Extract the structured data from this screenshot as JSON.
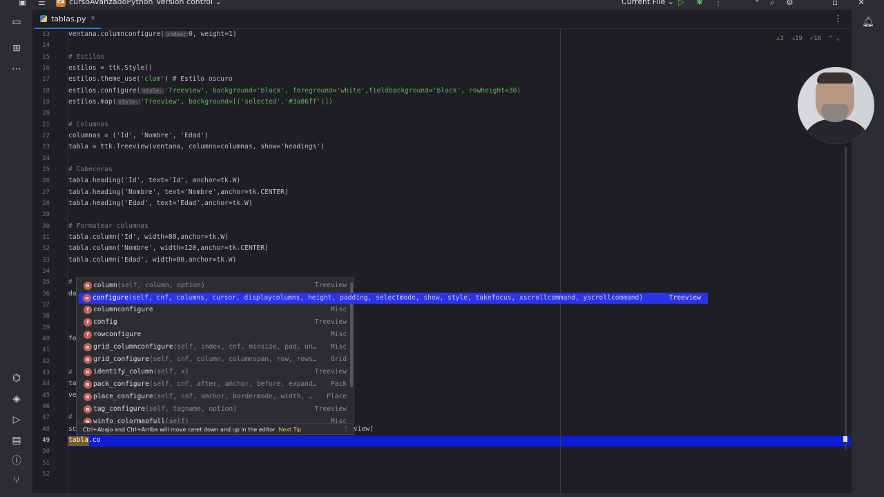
{
  "topbar": {
    "project_initials": "CA",
    "project_name": "cursoAvanzadoPython",
    "vcs_label": "Version control",
    "run_config": "Current File"
  },
  "tab": {
    "file_name": "tablas.py"
  },
  "inspection": {
    "warnings": "3",
    "weak_warnings": "19",
    "typos": "16"
  },
  "gutter": {
    "lines": [
      "13",
      "14",
      "15",
      "16",
      "17",
      "18",
      "19",
      "20",
      "21",
      "22",
      "23",
      "24",
      "25",
      "26",
      "27",
      "28",
      "29",
      "30",
      "31",
      "32",
      "33",
      "34",
      "35",
      "36",
      "37",
      "38",
      "39",
      "40",
      "41",
      "42",
      "43",
      "44",
      "45",
      "46",
      "47",
      "48",
      "49",
      "50",
      "51",
      "52"
    ],
    "active_line": "49"
  },
  "code": {
    "l13": "ventana.columnconfigure(",
    "l13_hint": "index:",
    "l13_b": "0, weight=1)",
    "l15": "# Estilos",
    "l16": "estilos = ttk.Style()",
    "l17a": "estilos.theme_use(",
    "l17b": "'clam'",
    "l17c": ") # Estilo oscuro",
    "l18a": "estilos.configure(",
    "l18_hint": "style:",
    "l18b": "'Treeview', background='black', foreground='white',fieldbackground='black', rowheight=30)",
    "l19a": "estilos.map(",
    "l19_hint": "style:",
    "l19b": "'Treeview', background=[('selected','#3a86ff')])",
    "l21": "# Columnas",
    "l22": "columnas = ('Id', 'Nombre', 'Edad')",
    "l23": "tabla = ttk.Treeview(ventana, columns=columnas, show='headings')",
    "l25": "# Cabeceras",
    "l26": "tabla.heading('Id', text='Id', anchor=tk.W)",
    "l27": "tabla.heading('Nombre', text='Nombre',anchor=tk.CENTER)",
    "l28": "tabla.heading('Edad', text='Edad',anchor=tk.W)",
    "l30": "# Formatear columnas",
    "l31": "tabla.column('Id', width=80,anchor=tk.W)",
    "l32": "tabla.column('Nombre', width=120,anchor=tk.CENTER)",
    "l33": "tabla.column('Edad', width=80,anchor=tk.W)",
    "l35": "#",
    "l36": "da",
    "l40": "fo",
    "l43": "#",
    "l44": "ta",
    "l45": "ve",
    "l47": "#",
    "l48": "sc",
    "l48_tail": "view)",
    "l49a": "tabla",
    "l49b": ".co"
  },
  "completion": {
    "items": [
      {
        "badge": "m",
        "name": "column",
        "params": "(self, column, option)",
        "type": "Treeview"
      },
      {
        "badge": "f",
        "name": "columnconfigure",
        "params": "",
        "type": "Misc"
      },
      {
        "badge": "f",
        "name": "config",
        "params": "",
        "type": "Treeview"
      },
      {
        "badge": "f",
        "name": "rowconfigure",
        "params": "",
        "type": "Misc"
      },
      {
        "badge": "m",
        "name": "grid_columnconfigure",
        "params": "(self, index, cnf, minsize, pad, un…",
        "type": "Misc"
      },
      {
        "badge": "m",
        "name": "grid_configure",
        "params": "(self, cnf, column, columnspan, row, rows…",
        "type": "Grid"
      },
      {
        "badge": "m",
        "name": "identify_column",
        "params": "(self, x)",
        "type": "Treeview"
      },
      {
        "badge": "m",
        "name": "pack_configure",
        "params": "(self, cnf, after, anchor, before, expand…",
        "type": "Pack"
      },
      {
        "badge": "m",
        "name": "place_configure",
        "params": "(self, cnf, anchor, bordermode, width, …",
        "type": "Place"
      },
      {
        "badge": "m",
        "name": "tag_configure",
        "params": "(self, tagname, option)",
        "type": "Treeview"
      },
      {
        "badge": "m",
        "name": "winfo_colormapfull",
        "params": "(self)",
        "type": "Misc"
      }
    ],
    "selected": {
      "badge": "m",
      "name": "configure",
      "params": "(self, cnf, columns, cursor, displaycolumns, height, padding, selectmode, show, style, takefocus, xscrollcommand, yscrollcommand)",
      "type": "Treeview"
    },
    "footer_text": "Ctrl+Abajo and Ctrl+Arriba will move caret down and up in the editor",
    "footer_link": "Next Tip"
  },
  "colors": {
    "selection": "#2d33e6",
    "caret_row": "#0d1dd6",
    "editor_bg": "#1e1f22",
    "chrome_bg": "#2b2d30"
  }
}
